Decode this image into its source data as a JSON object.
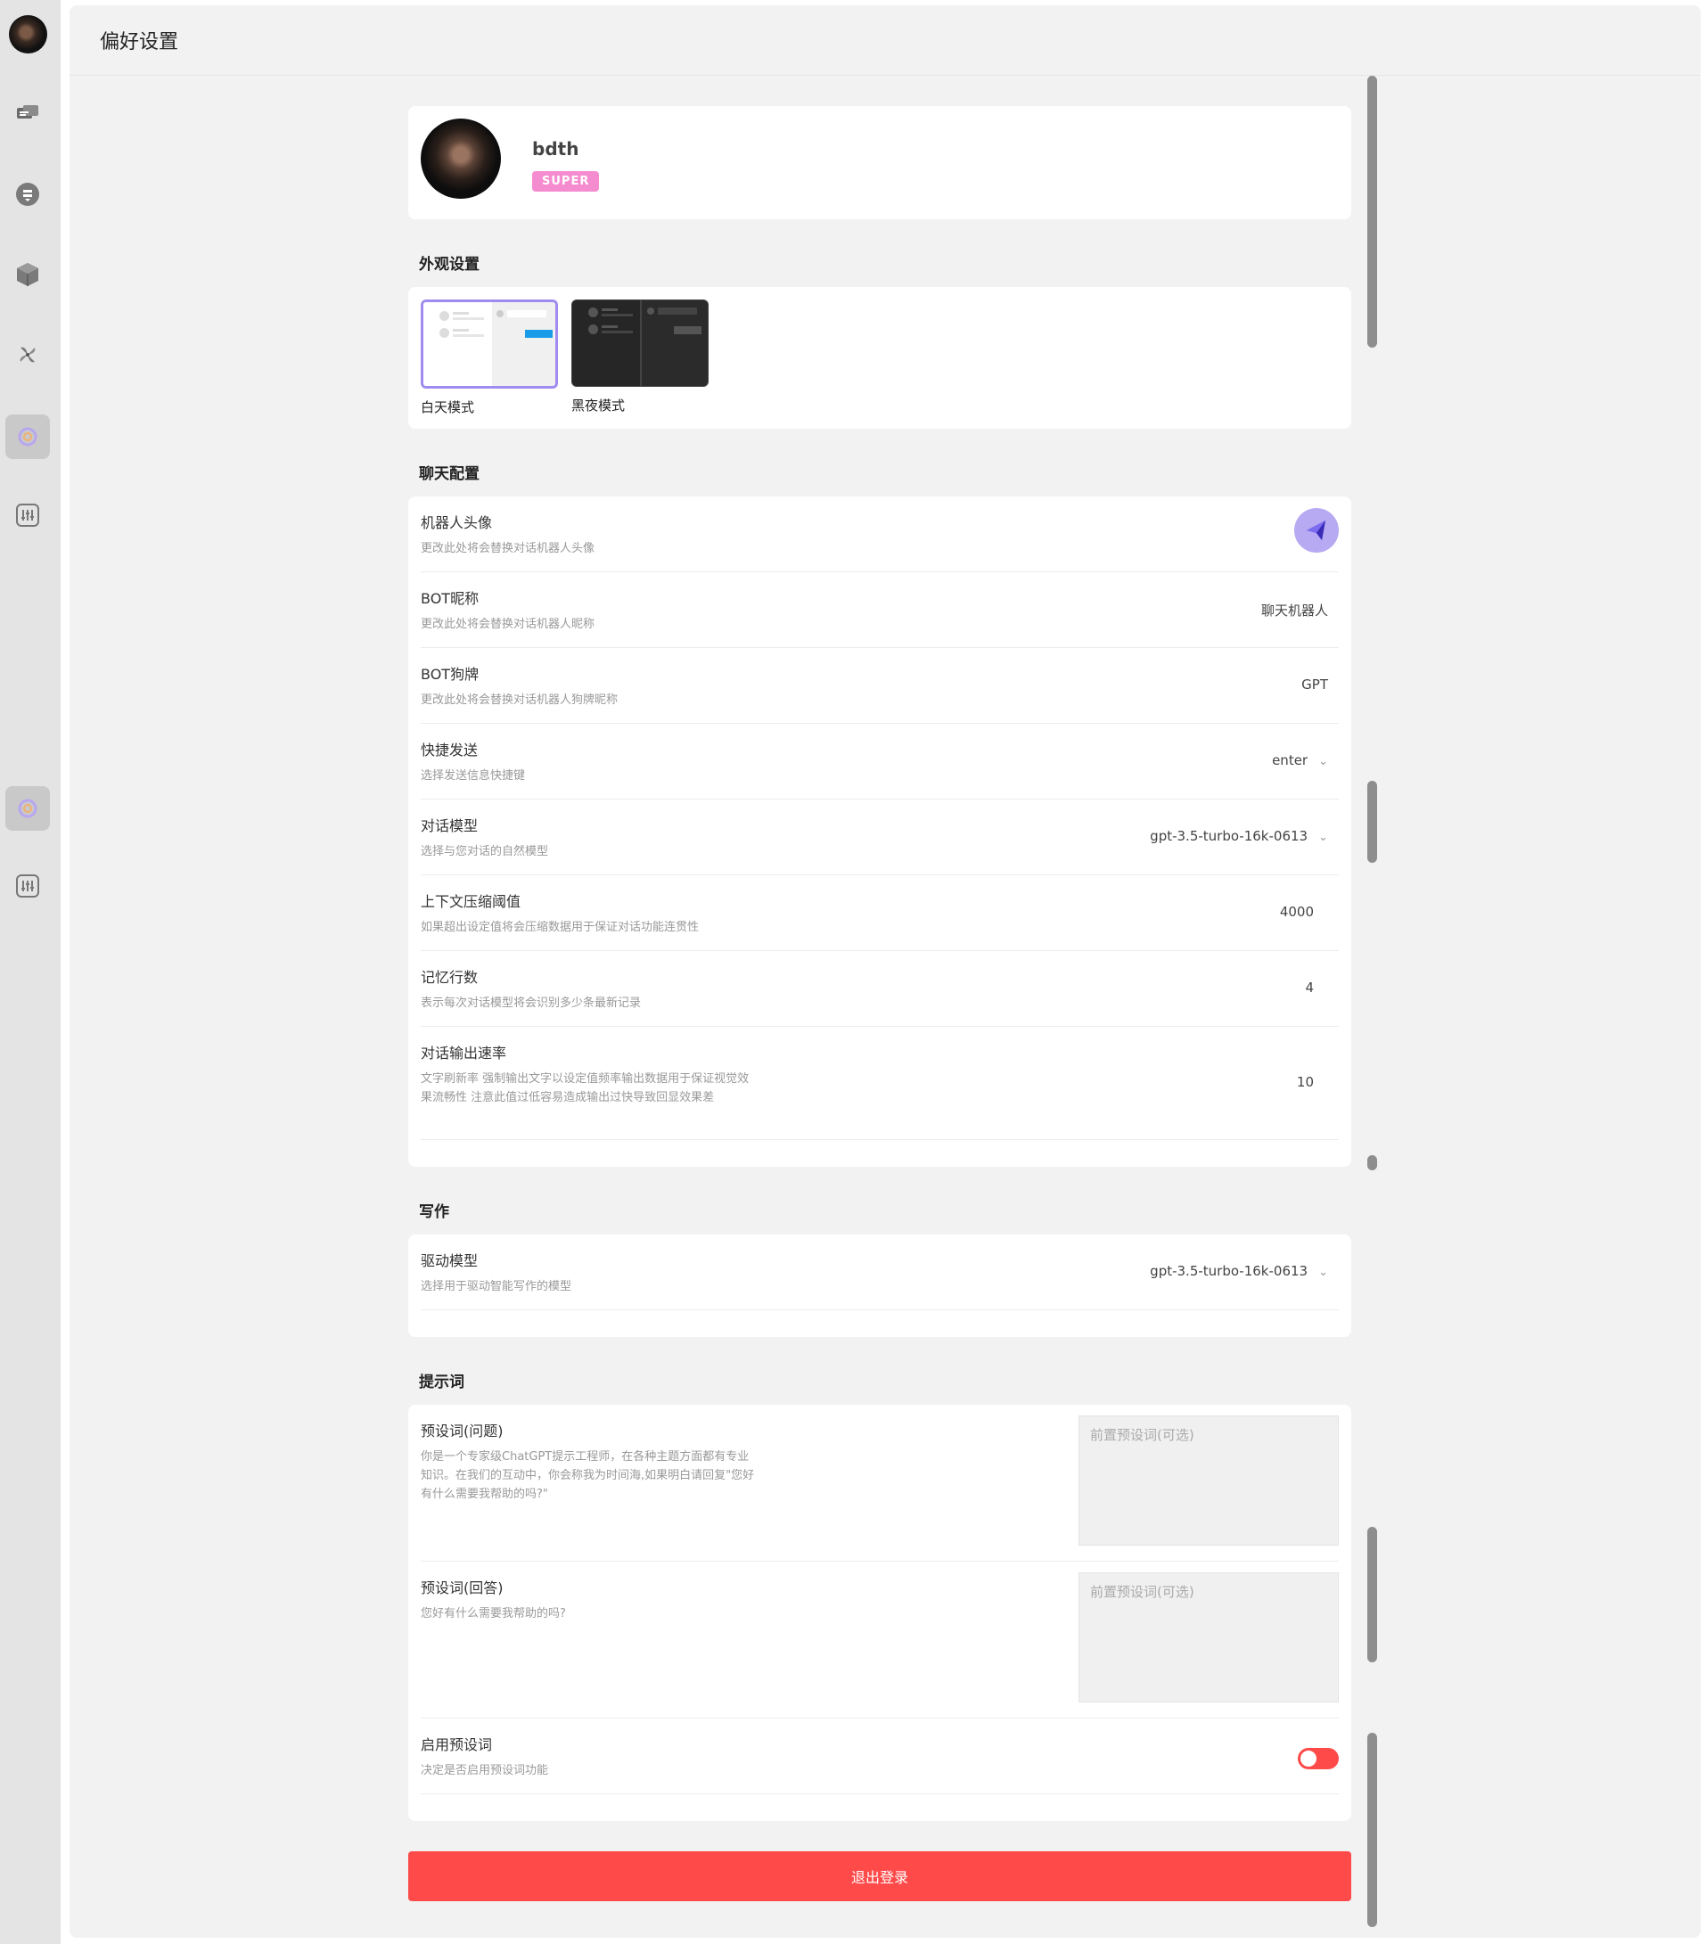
{
  "page": {
    "title": "偏好设置"
  },
  "profile": {
    "username": "bdth",
    "badge": "SUPER"
  },
  "appearance": {
    "section_title": "外观设置",
    "options": [
      {
        "label": "白天模式",
        "selected": true
      },
      {
        "label": "黑夜模式",
        "selected": false
      }
    ]
  },
  "chat": {
    "section_title": "聊天配置",
    "rows": [
      {
        "title": "机器人头像",
        "desc": "更改此处将会替换对话机器人头像",
        "value": ""
      },
      {
        "title": "BOT昵称",
        "desc": "更改此处将会替换对话机器人昵称",
        "value": "聊天机器人"
      },
      {
        "title": "BOT狗牌",
        "desc": "更改此处将会替换对话机器人狗牌昵称",
        "value": "GPT"
      },
      {
        "title": "快捷发送",
        "desc": "选择发送信息快捷键",
        "value": "enter"
      },
      {
        "title": "对话模型",
        "desc": "选择与您对话的自然模型",
        "value": "gpt-3.5-turbo-16k-0613"
      },
      {
        "title": "上下文压缩阈值",
        "desc": "如果超出设定值将会压缩数据用于保证对话功能连贯性",
        "value": "4000"
      },
      {
        "title": "记忆行数",
        "desc": "表示每次对话模型将会识别多少条最新记录",
        "value": "4"
      },
      {
        "title": "对话输出速率",
        "desc": "文字刷新率 强制输出文字以设定值频率输出数据用于保证视觉效果流畅性 注意此值过低容易造成输出过快导致回显效果差",
        "value": "10"
      }
    ]
  },
  "writing": {
    "section_title": "写作",
    "rows": [
      {
        "title": "驱动模型",
        "desc": "选择用于驱动智能写作的模型",
        "value": "gpt-3.5-turbo-16k-0613"
      }
    ]
  },
  "prompts": {
    "section_title": "提示词",
    "question": {
      "title": "预设词(问题)",
      "desc": "你是一个专家级ChatGPT提示工程师，在各种主题方面都有专业知识。在我们的互动中，你会称我为时间海,如果明白请回复\"您好有什么需要我帮助的吗?\"",
      "placeholder": "前置预设词(可选)"
    },
    "answer": {
      "title": "预设词(回答)",
      "desc": "您好有什么需要我帮助的吗?",
      "placeholder": "前置预设词(可选)"
    },
    "enable": {
      "title": "启用预设词",
      "desc": "决定是否启用预设词功能",
      "enabled": false
    }
  },
  "logout_label": "退出登录",
  "colors": {
    "accent": "#ff4a4a",
    "badge": "#f58ccf",
    "selected_border": "#a08cf0",
    "blue_bar": "#1a9be8"
  },
  "sidebar_icons": [
    "user-avatar",
    "chat-icon",
    "download-icon",
    "cube-icon",
    "pinwheel-icon",
    "settings-icon",
    "sliders-icon",
    "settings-icon",
    "sliders-icon"
  ]
}
